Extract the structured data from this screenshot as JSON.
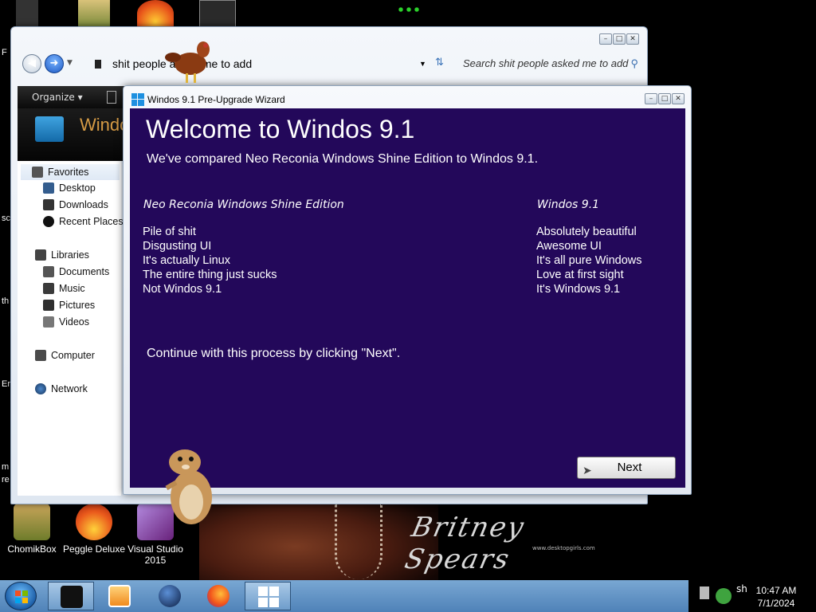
{
  "explorer": {
    "address": "shit people asked me to add",
    "search_placeholder": "Search shit people asked me to add",
    "toolbar_organize": "Organize",
    "banner_text": "Windo",
    "nav": {
      "favorites": "Favorites",
      "desktop": "Desktop",
      "downloads": "Downloads",
      "recent_places": "Recent Places",
      "libraries": "Libraries",
      "documents": "Documents",
      "music": "Music",
      "pictures": "Pictures",
      "videos": "Videos",
      "computer": "Computer",
      "network": "Network"
    }
  },
  "wizard": {
    "title": "Windos 9.1 Pre-Upgrade Wizard",
    "heading": "Welcome to Windos 9.1",
    "subheading": "We've compared Neo Reconia Windows Shine Edition  to Windos 9.1.",
    "left_column": {
      "header": "Neo Reconia Windows Shine Edition",
      "items": [
        "Pile of shit",
        "Disgusting UI",
        "It's actually Linux",
        "The entire thing just sucks",
        "Not Windos 9.1"
      ]
    },
    "right_column": {
      "header": "Windos 9.1",
      "items": [
        "Absolutely beautiful",
        "Awesome UI",
        "It's all pure Windows",
        "Love at first sight",
        "It's Windows 9.1"
      ]
    },
    "continue_text": "Continue with this process by clicking \"Next\".",
    "next_label": "Next"
  },
  "desktop_icons": [
    {
      "label": "ChomikBox"
    },
    {
      "label": "Peggle Deluxe"
    },
    {
      "label": "Visual Studio 2015"
    }
  ],
  "left_fragments": [
    "F",
    "sc",
    "th",
    "Er",
    "m",
    "re"
  ],
  "wallpaper": {
    "signature": "Britney Spears",
    "url": "www.desktopgirls.com"
  },
  "taskbar": {
    "time": "10:47 AM",
    "date": "7/1/2024",
    "tray_text": "sh"
  },
  "colors": {
    "wizard_background": "#23085a",
    "taskbar": "#5e90c4",
    "banner_text": "#d69b45"
  }
}
